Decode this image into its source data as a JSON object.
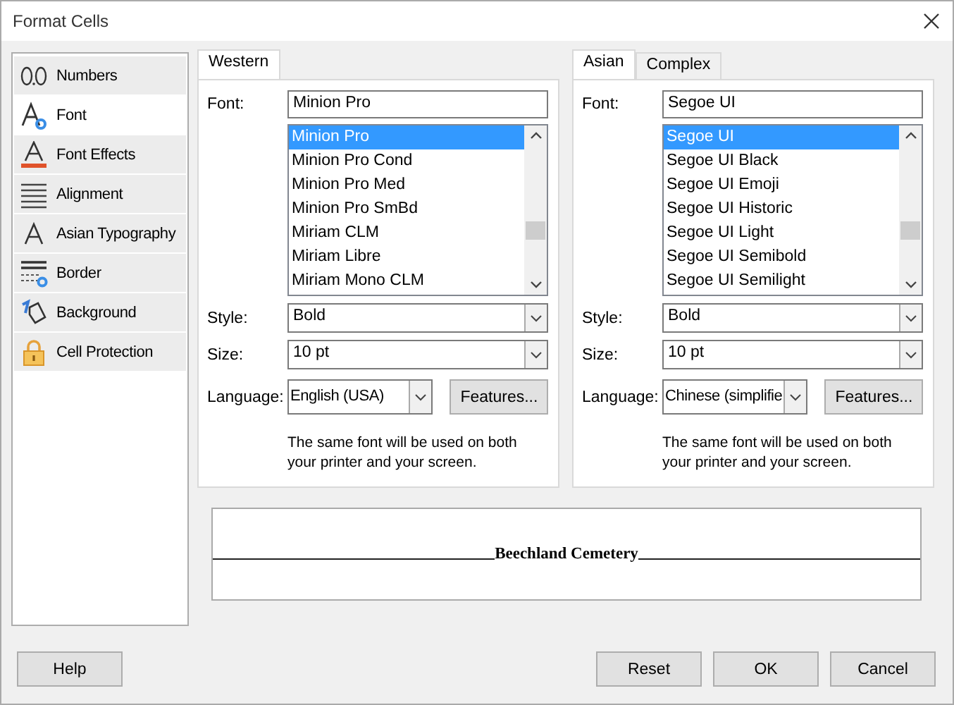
{
  "window": {
    "title": "Format Cells"
  },
  "sidebar": {
    "items": [
      {
        "label": "Numbers",
        "kind": "numbers",
        "selected": false
      },
      {
        "label": "Font",
        "kind": "font",
        "selected": true
      },
      {
        "label": "Font Effects",
        "kind": "effects",
        "selected": false
      },
      {
        "label": "Alignment",
        "kind": "alignment",
        "selected": false
      },
      {
        "label": "Asian Typography",
        "kind": "asian",
        "selected": false
      },
      {
        "label": "Border",
        "kind": "border",
        "selected": false
      },
      {
        "label": "Background",
        "kind": "background",
        "selected": false
      },
      {
        "label": "Cell Protection",
        "kind": "protection",
        "selected": false
      }
    ]
  },
  "panels": [
    {
      "tabs": [
        {
          "label": "Western",
          "selected": true
        }
      ],
      "font_label": "Font:",
      "font_value": "Minion Pro",
      "font_list": [
        {
          "label": "Minion Pro",
          "selected": true
        },
        {
          "label": "Minion Pro Cond",
          "selected": false
        },
        {
          "label": "Minion Pro Med",
          "selected": false
        },
        {
          "label": "Minion Pro SmBd",
          "selected": false
        },
        {
          "label": "Miriam CLM",
          "selected": false
        },
        {
          "label": "Miriam Libre",
          "selected": false
        },
        {
          "label": "Miriam Mono CLM",
          "selected": false
        }
      ],
      "style_label": "Style:",
      "style_value": "Bold",
      "size_label": "Size:",
      "size_value": "10 pt",
      "language_label": "Language:",
      "language_value": "English (USA)",
      "features_button": "Features...",
      "note": "The same font will be used on both your printer and your screen."
    },
    {
      "tabs": [
        {
          "label": "Asian",
          "selected": true
        },
        {
          "label": "Complex",
          "selected": false
        }
      ],
      "font_label": "Font:",
      "font_value": "Segoe UI",
      "font_list": [
        {
          "label": "Segoe UI",
          "selected": true
        },
        {
          "label": "Segoe UI Black",
          "selected": false
        },
        {
          "label": "Segoe UI Emoji",
          "selected": false
        },
        {
          "label": "Segoe UI Historic",
          "selected": false
        },
        {
          "label": "Segoe UI Light",
          "selected": false
        },
        {
          "label": "Segoe UI Semibold",
          "selected": false
        },
        {
          "label": "Segoe UI Semilight",
          "selected": false
        }
      ],
      "style_label": "Style:",
      "style_value": "Bold",
      "size_label": "Size:",
      "size_value": "10 pt",
      "language_label": "Language:",
      "language_value": "Chinese (simplifie",
      "features_button": "Features...",
      "note": "The same font will be used on both your printer and your screen."
    }
  ],
  "preview": {
    "text": "Beechland Cemetery"
  },
  "buttons": {
    "help": "Help",
    "actions": [
      "Reset",
      "OK",
      "Cancel"
    ]
  }
}
